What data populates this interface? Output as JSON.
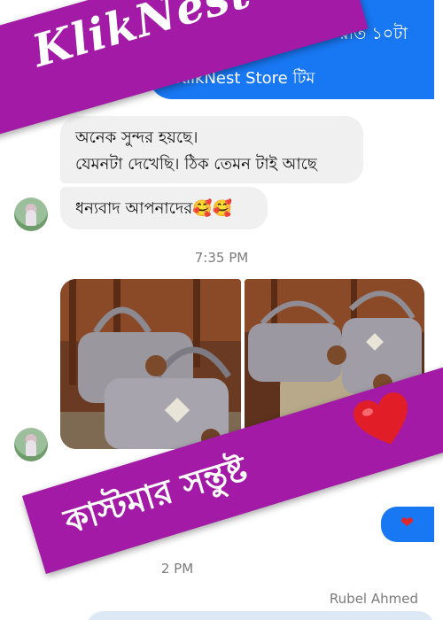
{
  "outgoing_top": {
    "line1": "১০টা – রাত ১০টা",
    "line2": "- KlikNest Store টিম"
  },
  "incoming": {
    "message1_line1": "অনেক সুন্দর হয়ছে।",
    "message1_line2": "যেমনটা দেখেছি। ঠিক তেমন টাই আছে",
    "message2": "ধন্যবাদ আপনাদের🥰🥰"
  },
  "timestamps": {
    "first": "7:35 PM",
    "second": "2 PM"
  },
  "outgoing_bottom": {
    "heart": "❤"
  },
  "sender_name": "Rubel Ahmed",
  "overlay": {
    "brand": "KlikNest",
    "caption": "কাস্টমার সন্তুষ্ট",
    "caption_color": "#a21aa6"
  },
  "colors": {
    "outgoing_bubble": "#1877f2",
    "incoming_bubble": "#f0f0f0",
    "banner": "#a21aa6"
  },
  "icons": {
    "avatar": "avatar",
    "heart": "red-heart-icon"
  }
}
